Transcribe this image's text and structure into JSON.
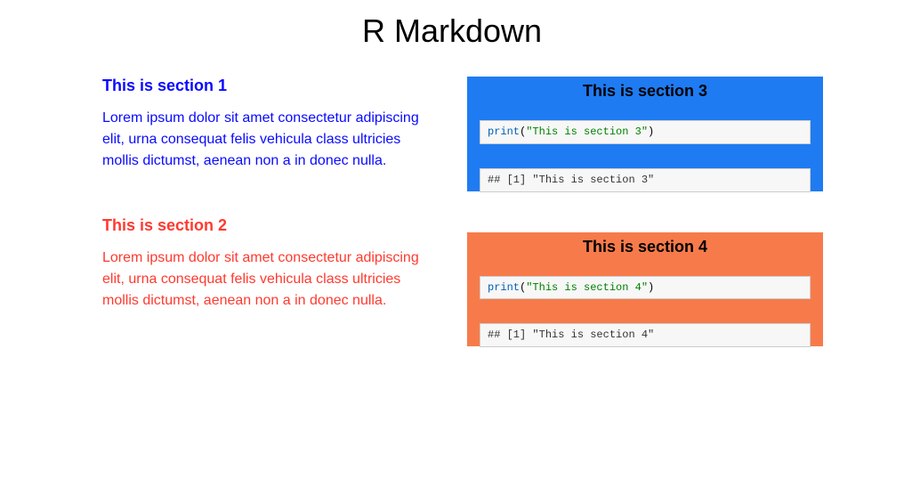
{
  "title": "R Markdown",
  "left": {
    "section1": {
      "heading": "This is section 1",
      "body": "Lorem ipsum dolor sit amet consectetur adipiscing elit, urna consequat felis vehicula class ultricies mollis dictumst, aenean non a in donec nulla."
    },
    "section2": {
      "heading": "This is section 2",
      "body": "Lorem ipsum dolor sit amet consectetur adipiscing elit, urna consequat felis vehicula class ultricies mollis dictumst, aenean non a in donec nulla."
    }
  },
  "right": {
    "section3": {
      "heading": "This is section 3",
      "code_fn": "print",
      "code_paren_open": "(",
      "code_str": "\"This is section 3\"",
      "code_paren_close": ")",
      "out_prefix": "## [1] ",
      "out_value": "\"This is section 3\""
    },
    "section4": {
      "heading": "This is section 4",
      "code_fn": "print",
      "code_paren_open": "(",
      "code_str": "\"This is section 4\"",
      "code_paren_close": ")",
      "out_prefix": "## [1] ",
      "out_value": "\"This is section 4\""
    }
  }
}
